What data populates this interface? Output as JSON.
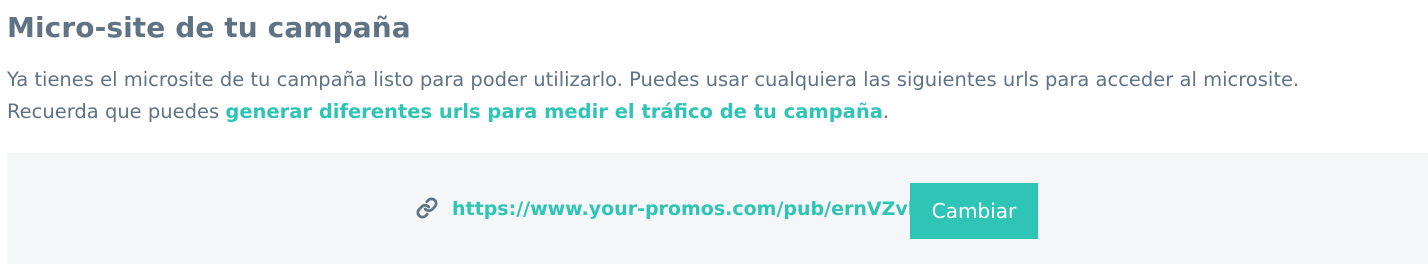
{
  "header": {
    "title": "Micro-site de tu campaña"
  },
  "description": {
    "line1": "Ya tienes el microsite de tu campaña listo para poder utilizarlo. Puedes usar cualquiera las siguientes urls para acceder al microsite.",
    "line2_prefix": "Recuerda que puedes ",
    "line2_link": "generar diferentes urls para medir el tráfico de tu campaña",
    "line2_suffix": "."
  },
  "microsite": {
    "icon": "link-icon",
    "url": "https://www.your-promos.com/pub/ernVZvl",
    "change_button": "Cambiar"
  },
  "colors": {
    "text": "#5f7384",
    "accent": "#2ec4b6",
    "panel_background": "#f5f6f8",
    "button_text": "#ffffff"
  }
}
